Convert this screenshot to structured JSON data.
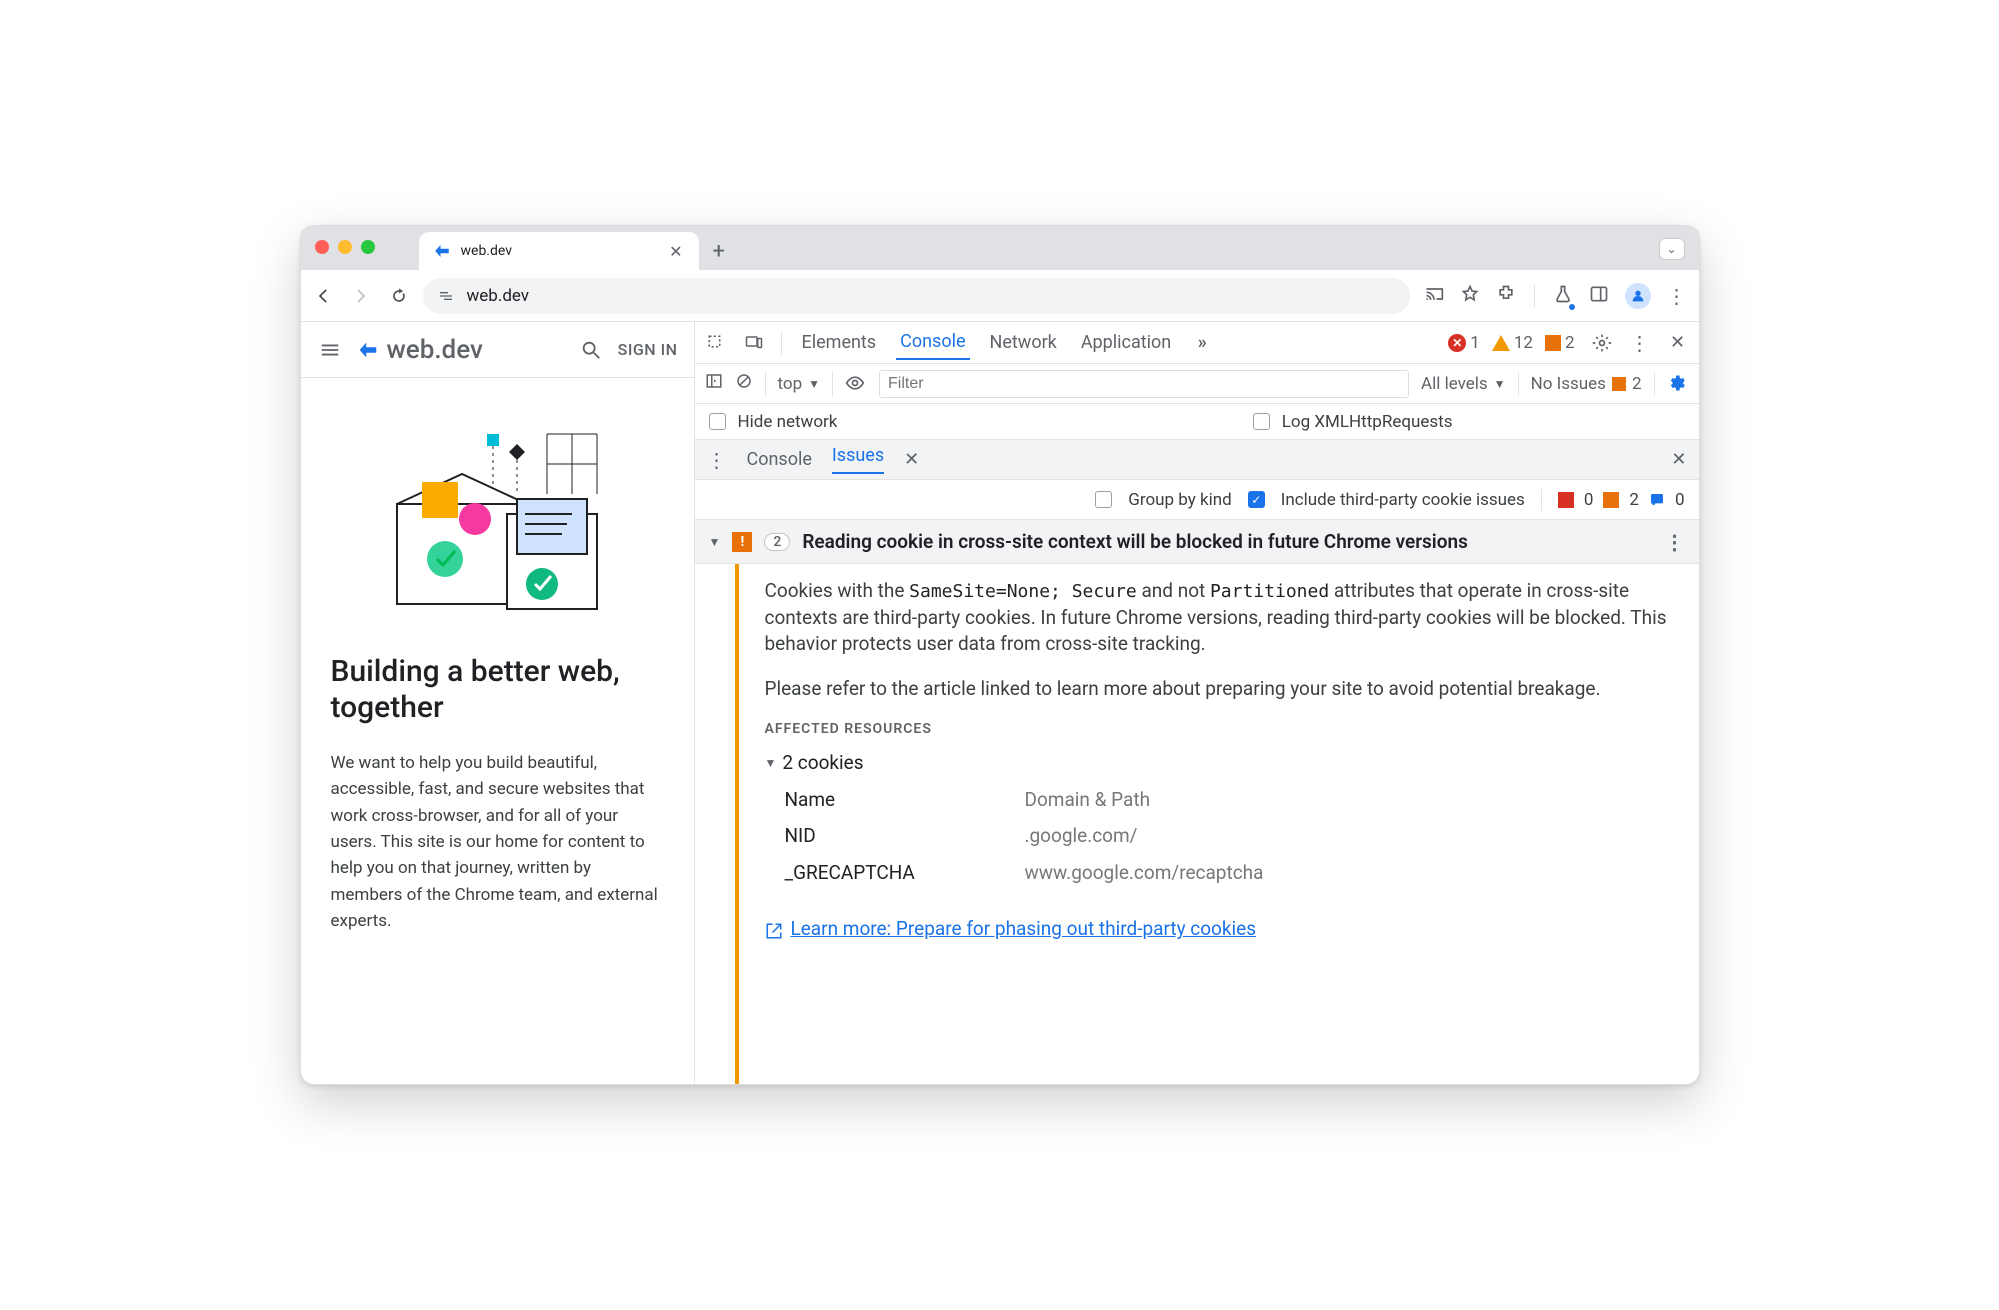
{
  "browser": {
    "tab_label": "web.dev",
    "omnibox_url": "web.dev"
  },
  "page": {
    "brand": "web.dev",
    "signin": "SIGN IN",
    "hero_title": "Building a better web, together",
    "hero_body": "We want to help you build beautiful, accessible, fast, and secure websites that work cross-browser, and for all of your users. This site is our home for content to help you on that journey, written by members of the Chrome team, and external experts."
  },
  "devtools": {
    "tabs": {
      "elements": "Elements",
      "console": "Console",
      "network": "Network",
      "application": "Application"
    },
    "counts": {
      "errors": "1",
      "warnings": "12",
      "issues": "2"
    },
    "console_toolbar": {
      "context": "top",
      "filter_placeholder": "Filter",
      "levels": "All levels",
      "no_issues": "No Issues",
      "issue_count": "2"
    },
    "netrow": {
      "hide_network": "Hide network",
      "log_xhr": "Log XMLHttpRequests"
    },
    "drawer": {
      "console": "Console",
      "issues": "Issues"
    },
    "issues_bar": {
      "group_by_kind": "Group by kind",
      "include_third_party": "Include third-party cookie issues",
      "c_red": "0",
      "c_orange": "2",
      "c_blue": "0"
    },
    "issue": {
      "count": "2",
      "title": "Reading cookie in cross-site context will be blocked in future Chrome versions",
      "para1a": "Cookies with the ",
      "code_samesite": "SameSite=None; Secure",
      "para1b": " and not ",
      "code_partitioned": "Partitioned",
      "para1c": " attributes that operate in cross-site contexts are third-party cookies. In future Chrome versions, reading third-party cookies will be blocked. This behavior protects user data from cross-site tracking.",
      "para2": "Please refer to the article linked to learn more about preparing your site to avoid potential breakage.",
      "affected": "AFFECTED RESOURCES",
      "cookies_label": "2 cookies",
      "col_name": "Name",
      "col_domain": "Domain & Path",
      "rows": [
        {
          "name": "NID",
          "domain": ".google.com/"
        },
        {
          "name": "_GRECAPTCHA",
          "domain": "www.google.com/recaptcha"
        }
      ],
      "learn_more": "Learn more: Prepare for phasing out third-party cookies"
    }
  }
}
